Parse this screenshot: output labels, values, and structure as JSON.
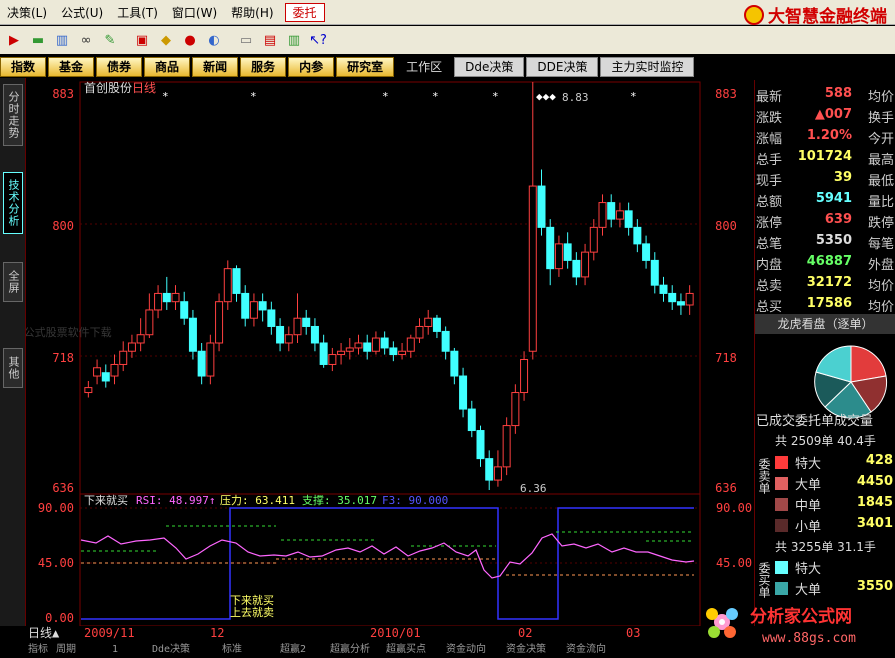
{
  "menu": {
    "items": [
      "决策(L)",
      "公式(U)",
      "工具(T)",
      "窗口(W)",
      "帮助(H)"
    ],
    "active": "委托",
    "brand": "大智慧金融终端"
  },
  "toolbar": {
    "icons": [
      "flag-icon",
      "scroll-icon",
      "chart-icon",
      "binoculars-icon",
      "notebook-icon",
      "dice-icon",
      "diamond-icon",
      "sign-icon",
      "bird-icon",
      "note-icon",
      "window-icon",
      "books-icon",
      "help-arrow-icon"
    ]
  },
  "tabs": [
    "指数",
    "基金",
    "债券",
    "商品",
    "新闻",
    "服务",
    "内参",
    "研究室"
  ],
  "tabs_extra": [
    "工作区",
    "Dde决策",
    "DDE决策",
    "主力实时监控"
  ],
  "sidetabs": [
    "分时走势",
    "技术分析",
    "全屏",
    "其他"
  ],
  "chart": {
    "title": "首创股份",
    "period": "日线",
    "axis_left": [
      "883",
      "800",
      "718",
      "636"
    ],
    "axis_right": [
      "883",
      "800",
      "718",
      "636"
    ],
    "high_label": "8.83",
    "low_label": "6.36",
    "watermark": "指 公式股票软件下载",
    "indicator": {
      "name": "下来就买",
      "rsi_label": "RSI: 48.997↑",
      "pressure_label": "压力: 63.411",
      "support_label": "支撑: 35.017",
      "f3_label": "F3: 90.000",
      "axis_left": [
        "90.00",
        "45.00",
        "0.00"
      ],
      "axis_right": [
        "90.00",
        "45.00"
      ],
      "annotation_1": "下来就买",
      "annotation_2": "上去就卖"
    },
    "dates": [
      "2009/11",
      "12",
      "2010/01",
      "02",
      "03"
    ],
    "period_label": "日线▲",
    "bottom_tabs": [
      "指标",
      "周期",
      "1",
      "Dde决策",
      "标准",
      "超赢2",
      "超赢分析",
      "超赢买点",
      "资金动向",
      "资金决策",
      "资金流向"
    ]
  },
  "quote": {
    "rows": [
      {
        "l": "最新",
        "v": "588",
        "r": "均价",
        "c": "#ff5050"
      },
      {
        "l": "涨跌",
        "v": "▲007",
        "r": "换手",
        "c": "#ff5050"
      },
      {
        "l": "涨幅",
        "v": "1.20%",
        "r": "今开",
        "c": "#ff5050"
      },
      {
        "l": "总手",
        "v": "101724",
        "r": "最高",
        "c": "#ffff66"
      },
      {
        "l": "现手",
        "v": "39",
        "r": "最低",
        "c": "#ffff66"
      },
      {
        "l": "总额",
        "v": "5941",
        "r": "量比",
        "c": "#66ffff"
      },
      {
        "l": "涨停",
        "v": "639",
        "r": "跌停",
        "c": "#ff5050"
      },
      {
        "l": "总笔",
        "v": "5350",
        "r": "每笔",
        "c": "#dddddd"
      },
      {
        "l": "内盘",
        "v": "46887",
        "r": "外盘",
        "c": "#66ff66"
      },
      {
        "l": "总卖",
        "v": "32172",
        "r": "均价",
        "c": "#ffff66"
      },
      {
        "l": "总买",
        "v": "17586",
        "r": "均价",
        "c": "#ffff66"
      }
    ],
    "banner": "龙虎看盘（逐单）",
    "order_title": "已成交委托单成交量",
    "sell": {
      "head": "共 2509单 40.4手",
      "side": "委卖单",
      "items": [
        {
          "l": "特大",
          "v": "428",
          "c": "#ff3b3b"
        },
        {
          "l": "大单",
          "v": "4450",
          "c": "#e06060"
        },
        {
          "l": "中单",
          "v": "1845",
          "c": "#a04848"
        },
        {
          "l": "小单",
          "v": "3401",
          "c": "#5a2a2a"
        }
      ]
    },
    "buy": {
      "head": "共 3255单 31.1手",
      "side": "委买单",
      "items": [
        {
          "l": "特大",
          "v": "",
          "c": "#66ffff"
        },
        {
          "l": "大单",
          "v": "3550",
          "c": "#3aa7a7"
        }
      ]
    }
  },
  "watermark2": {
    "text": "分析家公式网",
    "url": "www.88gs.com"
  }
}
